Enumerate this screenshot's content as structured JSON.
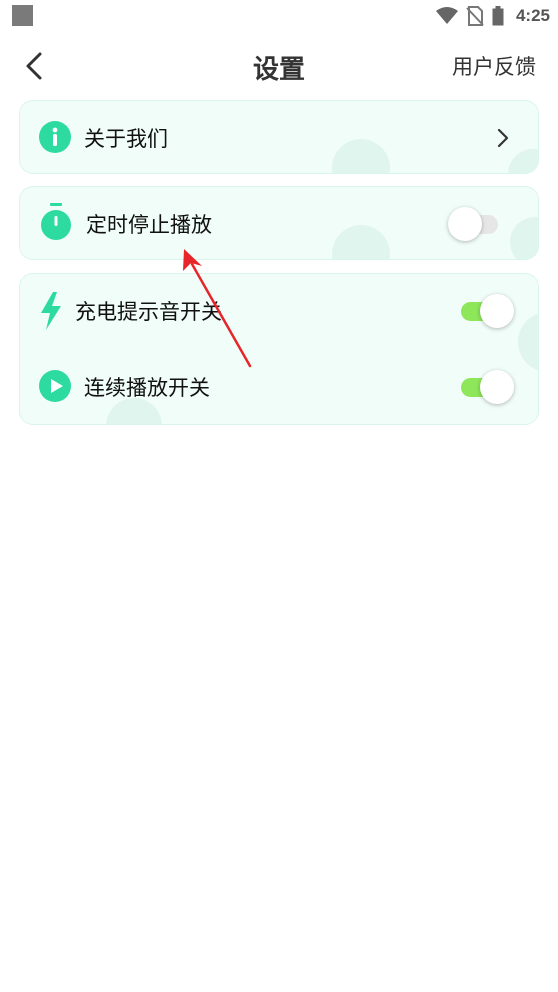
{
  "status_bar": {
    "time": "4:25"
  },
  "header": {
    "title": "设置",
    "feedback_label": "用户反馈"
  },
  "settings": {
    "about": {
      "label": "关于我们"
    },
    "timer": {
      "label": "定时停止播放",
      "enabled": false
    },
    "charge_sound": {
      "label": "充电提示音开关",
      "enabled": true
    },
    "continuous_play": {
      "label": "连续播放开关",
      "enabled": true
    }
  },
  "colors": {
    "accent": "#2ddba0",
    "toggle_on": "#8ee65a",
    "toggle_off": "#e6e6e6",
    "card_bg": "#f1fdf9",
    "annotation_arrow": "#e8262a"
  }
}
